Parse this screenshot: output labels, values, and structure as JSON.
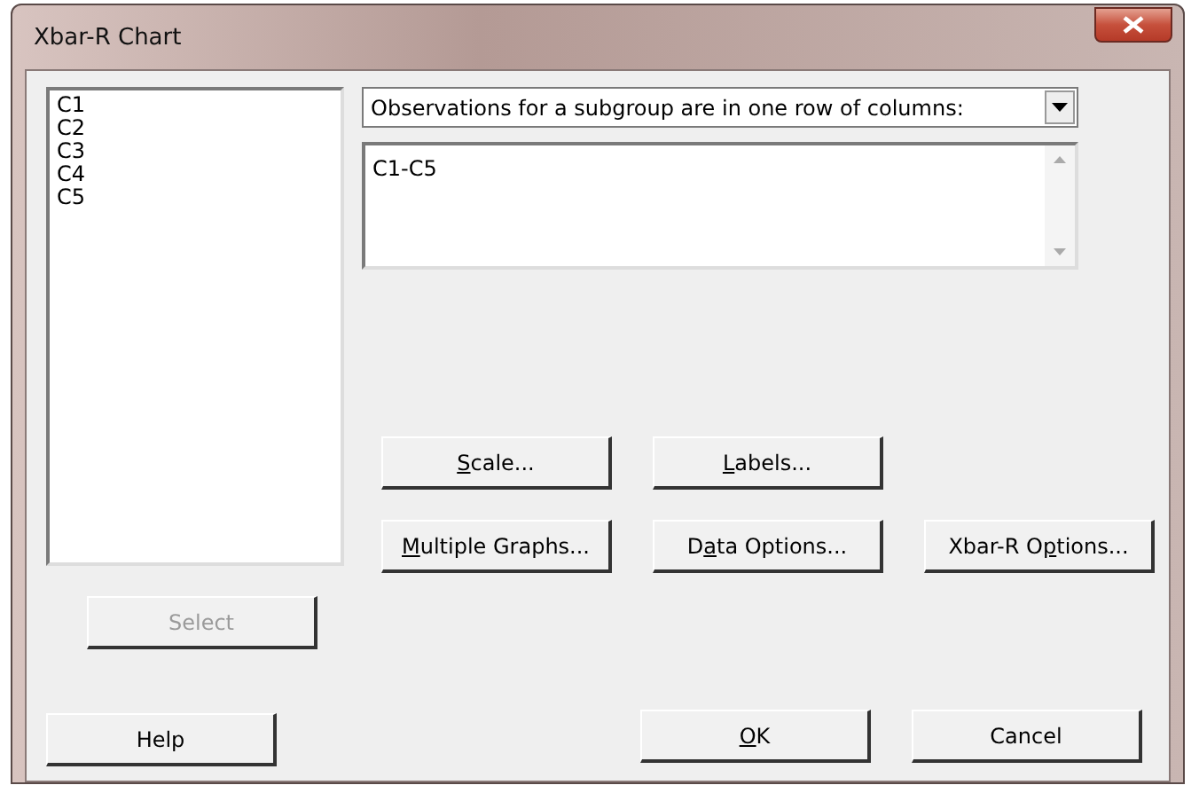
{
  "window": {
    "title": "Xbar-R Chart"
  },
  "variables": [
    "C1",
    "C2",
    "C3",
    "C4",
    "C5"
  ],
  "layout_dropdown": {
    "value": "Observations for a subgroup are in one row of columns:"
  },
  "columns_field": {
    "value": "C1-C5"
  },
  "option_rows": [
    [
      {
        "key": "S",
        "post": "cale..."
      },
      {
        "key": "L",
        "post": "abels..."
      }
    ],
    [
      {
        "key": "M",
        "post": "ultiple Graphs..."
      },
      {
        "pre": "D",
        "key": "a",
        "post": "ta Options..."
      },
      {
        "pre": "Xbar-R O",
        "key": "p",
        "post": "tions..."
      }
    ]
  ],
  "select_button": {
    "label": "Select",
    "disabled": true
  },
  "help_button": {
    "label": "Help"
  },
  "ok_button": {
    "key": "O",
    "post": "K"
  },
  "cancel_button": {
    "label": "Cancel"
  }
}
